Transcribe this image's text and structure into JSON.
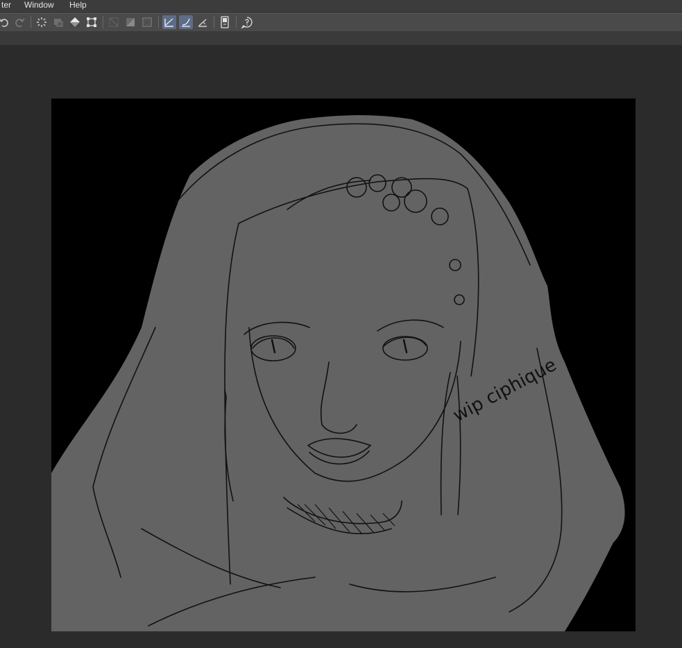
{
  "menubar": {
    "items": [
      {
        "label": "ter"
      },
      {
        "label": "Window"
      },
      {
        "label": "Help"
      }
    ]
  },
  "toolbar": {
    "buttons": [
      {
        "icon": "undo-icon"
      },
      {
        "icon": "redo-icon"
      },
      {
        "icon": "loading-spinner-icon"
      },
      {
        "icon": "clear-icon"
      },
      {
        "icon": "fill-icon"
      },
      {
        "icon": "transform-icon"
      },
      {
        "icon": "selection-off-icon"
      },
      {
        "icon": "invert-selection-icon"
      },
      {
        "icon": "selection-border-icon"
      },
      {
        "icon": "ruler-snap-icon"
      },
      {
        "icon": "curve-snap-icon"
      },
      {
        "icon": "perspective-ruler-icon"
      },
      {
        "icon": "device-icon"
      },
      {
        "icon": "help-icon"
      }
    ]
  },
  "canvas": {
    "background": "#000000",
    "figure_fill": "#636363",
    "line_color": "#111111",
    "handwritten_note": "wip ciphique"
  }
}
